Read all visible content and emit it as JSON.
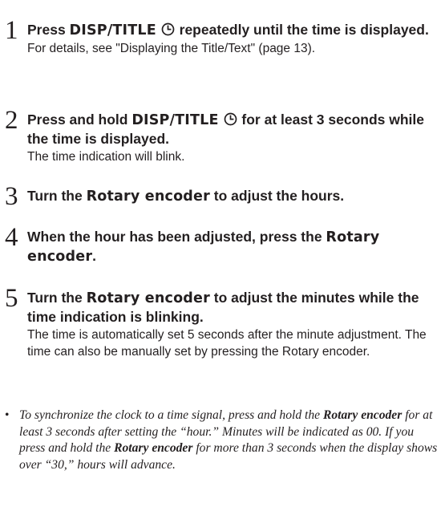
{
  "steps": [
    {
      "number": "1",
      "head_a": "Press ",
      "head_key": "DISP/TITLE",
      "head_b": " repeatedly until the time is displayed.",
      "desc": "For details, see \"Displaying the Title/Text\" (page 13)."
    },
    {
      "number": "2",
      "head_a": "Press and hold ",
      "head_key": "DISP/TITLE",
      "head_b": " for at least 3 seconds while the time is displayed.",
      "desc": "The time indication will blink."
    },
    {
      "number": "3",
      "head_a": "Turn the ",
      "head_key": "Rotary encoder",
      "head_b": " to adjust the hours."
    },
    {
      "number": "4",
      "head_a": "When the hour has been adjusted, press the ",
      "head_key": "Rotary encoder",
      "head_b": "."
    },
    {
      "number": "5",
      "head_a": "Turn the ",
      "head_key": "Rotary encoder",
      "head_b": " to adjust the minutes while the time indication is blinking.",
      "desc": "The time is automatically set 5 seconds after the minute adjustment. The time can also be manually set by pressing the Rotary encoder."
    }
  ],
  "icons": {
    "timer": "clock-icon"
  },
  "note": {
    "bullet": "•",
    "t1": "To synchronize the clock to a time signal, press and hold the ",
    "b1": "Rotary encoder",
    "t2": " for at least 3 seconds after setting the “hour.” Minutes will be indicated as 00.  If you press and hold the ",
    "b2": "Rotary encoder",
    "t3": " for more than 3 seconds when the display shows over “30,” hours will advance."
  }
}
